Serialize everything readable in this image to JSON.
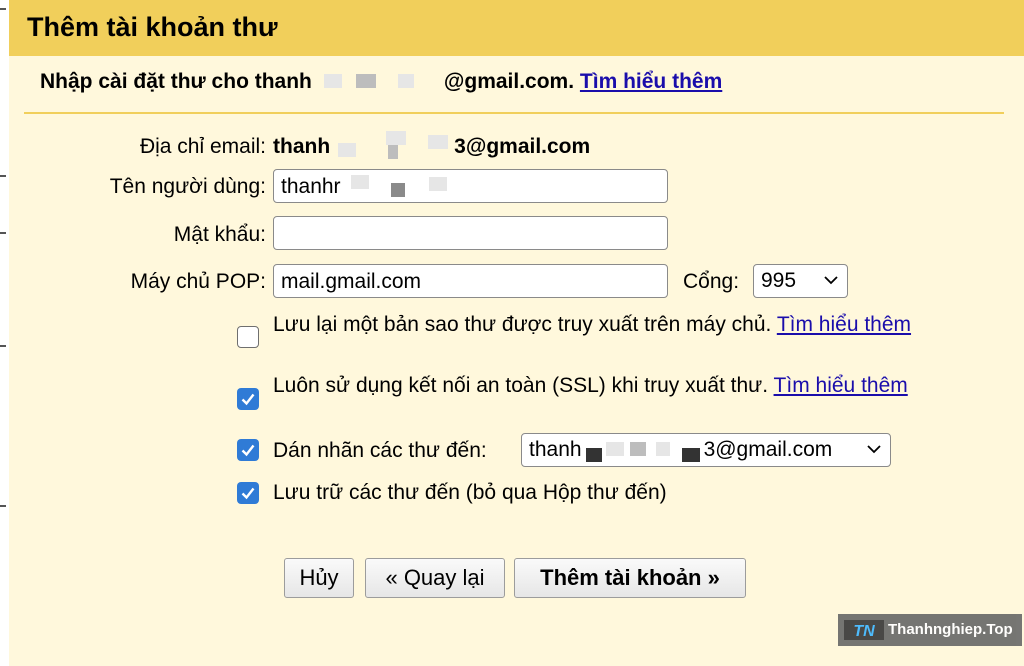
{
  "dialog": {
    "title": "Thêm tài khoản thư",
    "intro_prefix": "Nhập cài đặt thư cho thanh",
    "intro_suffix": "@gmail.com.",
    "intro_link": "Tìm hiểu thêm"
  },
  "form": {
    "email_label": "Địa chỉ email:",
    "email_prefix": "thanh",
    "email_suffix": "3@gmail.com",
    "username_label": "Tên người dùng:",
    "username_value": "thanhr",
    "password_label": "Mật khẩu:",
    "password_value": "",
    "pop_label": "Máy chủ POP:",
    "pop_value": "mail.gmail.com",
    "port_label": "Cổng:",
    "port_value": "995"
  },
  "options": [
    {
      "checked": false,
      "text": "Lưu lại một bản sao thư được truy xuất trên máy chủ.",
      "link": "Tìm hiểu thêm"
    },
    {
      "checked": true,
      "text": "Luôn sử dụng kết nối an toàn (SSL) khi truy xuất thư.",
      "link": "Tìm hiểu thêm"
    },
    {
      "checked": true,
      "text": "Dán nhãn các thư đến:",
      "select_prefix": "thanh",
      "select_suffix": "3@gmail.com"
    },
    {
      "checked": true,
      "text": "Lưu trữ các thư đến (bỏ qua Hộp thư đến)"
    }
  ],
  "buttons": {
    "cancel": "Hủy",
    "back": "« Quay lại",
    "add": "Thêm tài khoản »"
  },
  "watermark": {
    "logo_text": "TN",
    "text": "Thanhnghiep.Top"
  },
  "colors": {
    "title_bar": "#f1cf5b",
    "panel": "#fff8dc",
    "link": "#1a0dab",
    "checkbox": "#2f7bd6"
  }
}
